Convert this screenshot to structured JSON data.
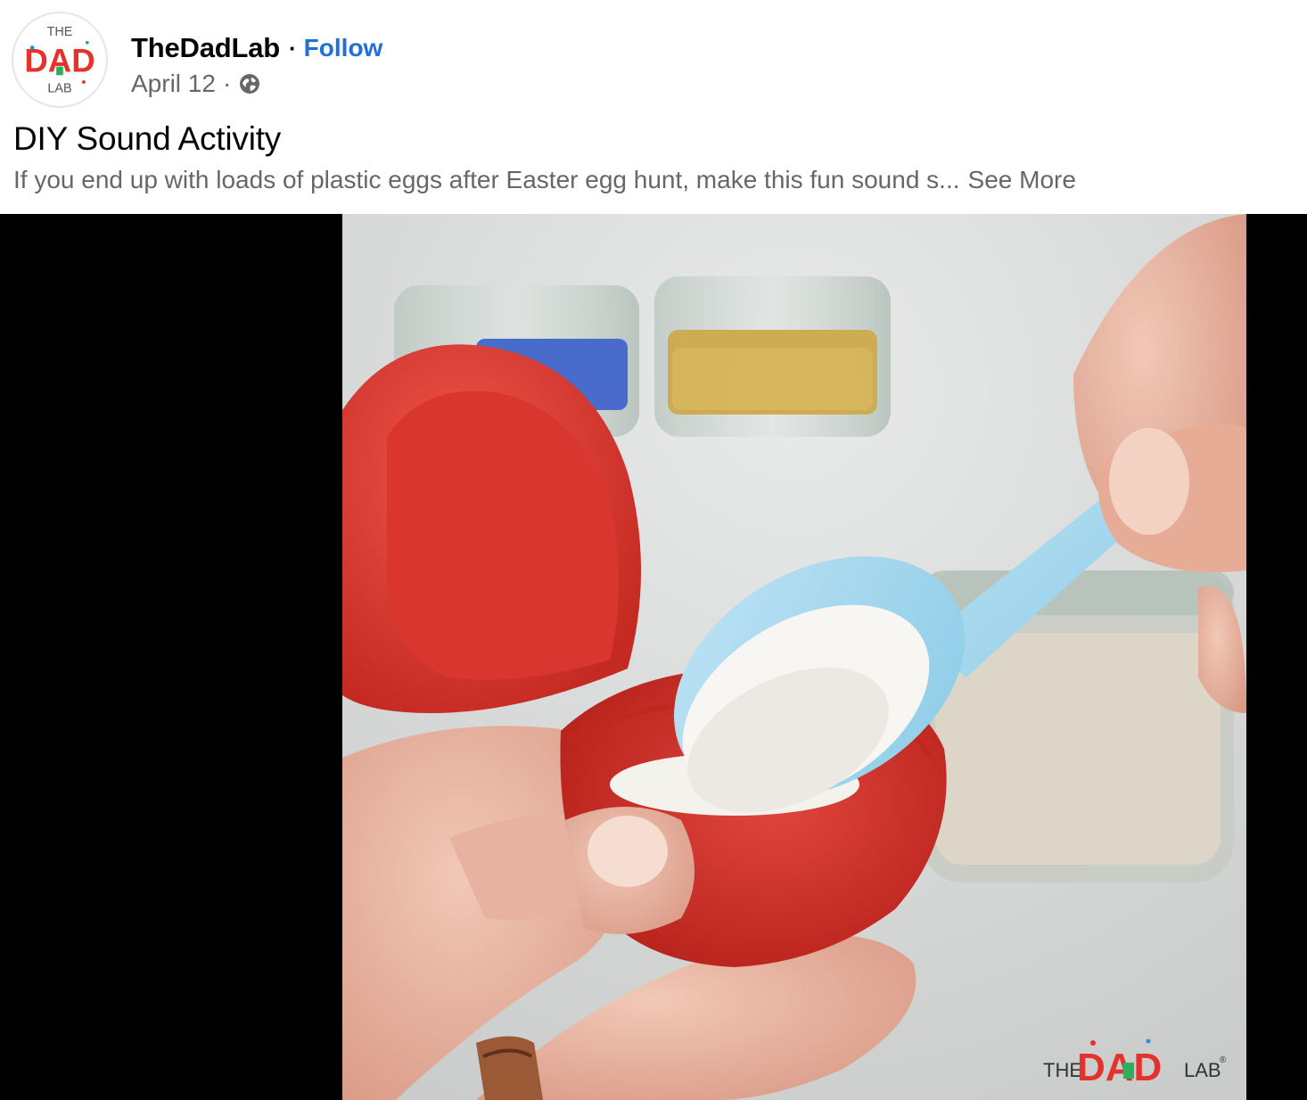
{
  "post": {
    "page_name": "TheDadLab",
    "separator": "·",
    "follow_label": "Follow",
    "date": "April 12",
    "meta_separator": "·",
    "audience_icon": "globe-icon",
    "title": "DIY Sound Activity",
    "text_preview": "If you end up with loads of plastic eggs after Easter egg hunt, make this fun sound s...",
    "see_more_label": "See More"
  },
  "avatar": {
    "logo_top": "THE",
    "logo_middle": "DAD",
    "logo_bottom": "LAB"
  },
  "video": {
    "watermark_the": "THE",
    "watermark_dad": "DAD",
    "watermark_lab": "LAB",
    "watermark_reg": "®"
  },
  "colors": {
    "follow_link": "#216fdb",
    "secondary_text": "#65676b",
    "primary_text": "#050505",
    "video_background": "#000000",
    "brand_red": "#e5322d",
    "brand_green": "#2fae5d",
    "brand_blue": "#2a8fd6"
  }
}
